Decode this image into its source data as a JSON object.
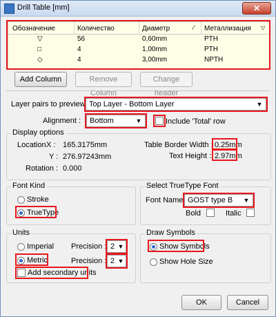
{
  "window": {
    "title": "Drill Table [mm]",
    "close_glyph": "✕"
  },
  "table": {
    "columns": [
      "Обозначение",
      "Количество",
      "Диаметр",
      "Металлизация"
    ],
    "rows": [
      {
        "symbol": "▽",
        "count": "56",
        "diameter": "0,60mm",
        "plating": "PTH"
      },
      {
        "symbol": "□",
        "count": "4",
        "diameter": "1,00mm",
        "plating": "PTH"
      },
      {
        "symbol": "◇",
        "count": "4",
        "diameter": "3,00mm",
        "plating": "NPTH"
      }
    ]
  },
  "buttons": {
    "add_column": "Add Column",
    "remove_column": "Remove Column",
    "change_header": "Change header",
    "ok": "OK",
    "cancel": "Cancel"
  },
  "layer_pairs": {
    "label": "Layer pairs to preview :",
    "value": "Top Layer - Bottom Layer"
  },
  "alignment": {
    "label": "Alignment :",
    "value": "Bottom",
    "include_total_label": "Include 'Total' row",
    "include_total_checked": false
  },
  "display_options": {
    "title": "Display options",
    "location_label": "Location",
    "x_label": "X :",
    "x_value": "165.3175mm",
    "y_label": "Y :",
    "y_value": "276.97243mm",
    "rotation_label": "Rotation :",
    "rotation_value": "0.000",
    "border_width_label": "Table Border Width :",
    "border_width_value": "0.25mm",
    "text_height_label": "Text Height :",
    "text_height_value": "2.97mm"
  },
  "font_kind": {
    "title": "Font Kind",
    "stroke_label": "Stroke",
    "truetype_label": "TrueType",
    "selected": "TrueType"
  },
  "truetype_font": {
    "title": "Select TrueType Font",
    "font_name_label": "Font Name",
    "font_name_value": "GOST type B",
    "bold_label": "Bold",
    "italic_label": "Italic"
  },
  "units": {
    "title": "Units",
    "imperial_label": "Imperial",
    "metric_label": "Metric",
    "selected": "Metric",
    "precision_label": "Precision :",
    "precision_imperial": "2",
    "precision_metric": "2",
    "add_secondary_label": "Add secondary units"
  },
  "draw_symbols": {
    "title": "Draw Symbols",
    "show_symbols_label": "Show Symbols",
    "show_hole_size_label": "Show Hole Size",
    "selected": "Show Symbols"
  },
  "colors": {
    "highlight": "#e8161c",
    "grid_bg": "#fefde6",
    "radio_dot": "#2f68c8"
  }
}
